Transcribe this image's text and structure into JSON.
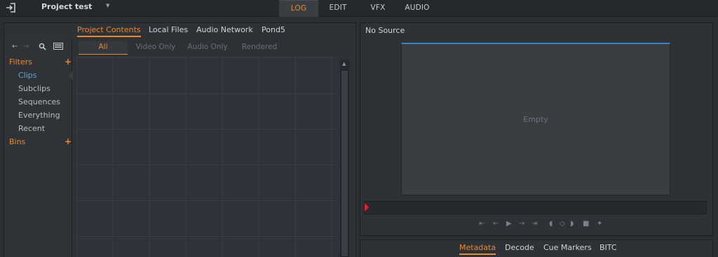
{
  "header": {
    "project_title": "Project test",
    "modes": [
      "LOG",
      "EDIT",
      "VFX",
      "AUDIO"
    ],
    "active_mode": "LOG"
  },
  "browser": {
    "tabs": [
      "Project Contents",
      "Local Files",
      "Audio Network",
      "Pond5"
    ],
    "active_tab": "Project Contents",
    "filters_label": "Filters",
    "filter_items": [
      "Clips",
      "Subclips",
      "Sequences",
      "Everything",
      "Recent"
    ],
    "selected_filter": "Clips",
    "bins_label": "Bins",
    "sub_tabs": [
      "All",
      "Video Only",
      "Audio Only",
      "Rendered"
    ],
    "active_sub_tab": "All"
  },
  "viewer": {
    "source_label": "No Source",
    "empty_label": "Empty"
  },
  "metadata": {
    "tabs": [
      "Metadata",
      "Decode",
      "Cue Markers",
      "BITC"
    ],
    "active_tab": "Metadata"
  },
  "colors": {
    "accent": "#e88a2f",
    "selected": "#5fa6d8",
    "playhead": "#e2202a",
    "viewer_top_line": "#3b82c4"
  }
}
